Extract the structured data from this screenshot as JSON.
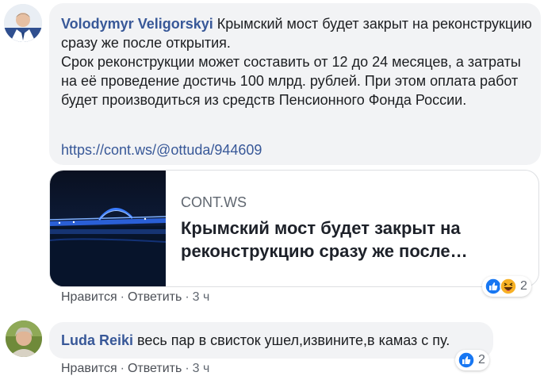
{
  "comment1": {
    "author": "Volodymyr Veligorskyi",
    "text_line1": "Крымский мост будет закрыт на реконструкцию сразу же после открытия.",
    "text_line2": "Срок реконструкции может составить от 12 до 24 месяцев, а затраты на её проведение достичь 100 млрд. рублей. При этом оплата работ будет производиться из средств Пенсионного Фонда России.",
    "link": "https://cont.ws/@ottuda/944609",
    "preview": {
      "domain": "CONT.WS",
      "title": "Крымский мост будет закрыт на реконструкцию сразу же после…"
    },
    "actions": {
      "like": "Нравится",
      "reply": "Ответить",
      "time": "3 ч"
    },
    "reactions": {
      "count": "2",
      "icons": [
        "like-icon",
        "haha-icon"
      ]
    }
  },
  "comment2": {
    "author": "Luda Reiki",
    "text": "весь пар в свисток ушел,извините,в камаз с пу.",
    "actions": {
      "like": "Нравится",
      "reply": "Ответить",
      "time": "3 ч"
    },
    "reactions": {
      "count": "2",
      "icons": [
        "like-icon"
      ]
    }
  },
  "colors": {
    "bubble_bg": "#f2f3f5",
    "author_link": "#385898",
    "like_blue": "#1877f2",
    "haha_yellow": "#f7b125"
  }
}
